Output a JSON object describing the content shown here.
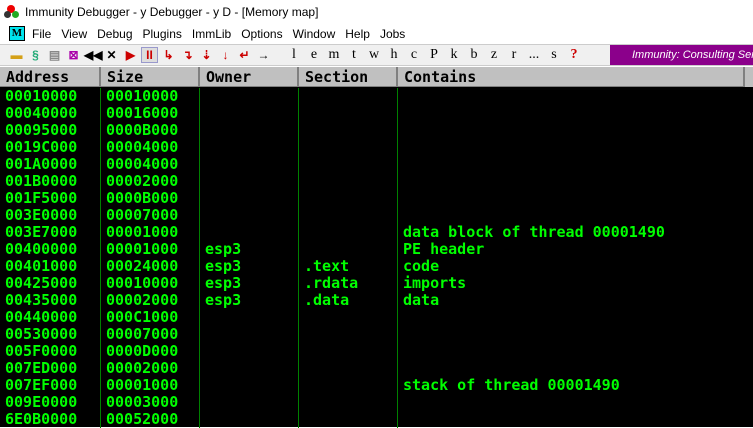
{
  "window": {
    "title": "Immunity Debugger - y Debugger - y D - [Memory map]"
  },
  "menu": {
    "logo": "M",
    "items": [
      "File",
      "View",
      "Debug",
      "Plugins",
      "ImmLib",
      "Options",
      "Window",
      "Help",
      "Jobs"
    ]
  },
  "toolbar": {
    "letters": [
      "l",
      "e",
      "m",
      "t",
      "w",
      "h",
      "c",
      "P",
      "k",
      "b",
      "z",
      "r",
      "...",
      "s",
      "?"
    ],
    "banner": "Immunity: Consulting Services"
  },
  "table": {
    "headers": [
      "Address",
      "Size",
      "Owner",
      "Section",
      "Contains"
    ],
    "rows": [
      [
        "00010000",
        "00010000",
        "",
        "",
        ""
      ],
      [
        "00040000",
        "00016000",
        "",
        "",
        ""
      ],
      [
        "00095000",
        "0000B000",
        "",
        "",
        ""
      ],
      [
        "0019C000",
        "00004000",
        "",
        "",
        ""
      ],
      [
        "001A0000",
        "00004000",
        "",
        "",
        ""
      ],
      [
        "001B0000",
        "00002000",
        "",
        "",
        ""
      ],
      [
        "001F5000",
        "0000B000",
        "",
        "",
        ""
      ],
      [
        "003E0000",
        "00007000",
        "",
        "",
        ""
      ],
      [
        "003E7000",
        "00001000",
        "",
        "",
        "data block of thread 00001490"
      ],
      [
        "00400000",
        "00001000",
        "esp3",
        "",
        "PE header"
      ],
      [
        "00401000",
        "00024000",
        "esp3",
        ".text",
        "code"
      ],
      [
        "00425000",
        "00010000",
        "esp3",
        ".rdata",
        "imports"
      ],
      [
        "00435000",
        "00002000",
        "esp3",
        ".data",
        "data"
      ],
      [
        "00440000",
        "000C1000",
        "",
        "",
        ""
      ],
      [
        "00530000",
        "00007000",
        "",
        "",
        ""
      ],
      [
        "005F0000",
        "0000D000",
        "",
        "",
        ""
      ],
      [
        "007ED000",
        "00002000",
        "",
        "",
        ""
      ],
      [
        "007EF000",
        "00001000",
        "",
        "",
        "stack of thread 00001490"
      ],
      [
        "009E0000",
        "00003000",
        "",
        "",
        ""
      ],
      [
        "6E0B0000",
        "00052000",
        "",
        "",
        ""
      ]
    ]
  }
}
